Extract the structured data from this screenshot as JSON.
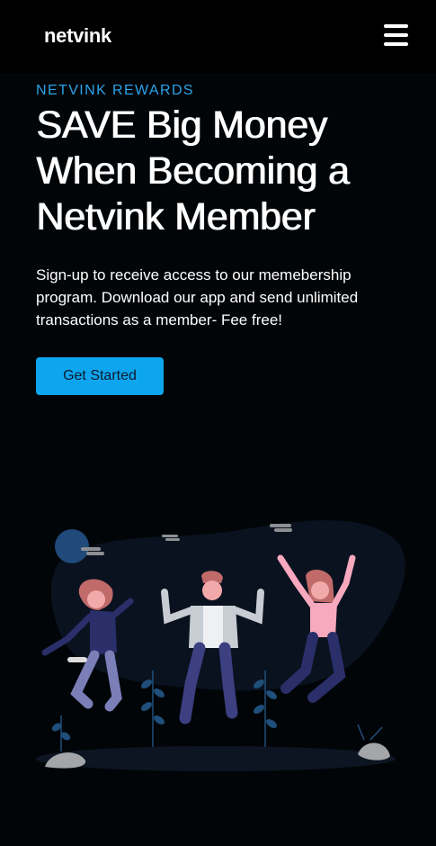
{
  "header": {
    "logo": "netvink",
    "menu_icon": "hamburger-menu-icon"
  },
  "hero": {
    "eyebrow": "NETVINK REWARDS",
    "headline": "SAVE Big Money When Becoming a Netvink Member",
    "description": "Sign-up to receive access to our memebership program. Download our app and send unlimited transactions as a member- Fee free!",
    "cta_label": "Get Started"
  },
  "colors": {
    "accent": "#2aa3ea",
    "button": "#0ea5ef",
    "background": "#020508",
    "header": "#000000"
  }
}
